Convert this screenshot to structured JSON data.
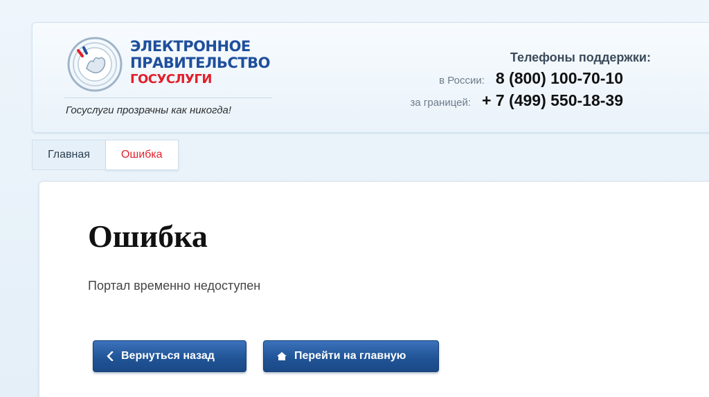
{
  "header": {
    "logo_lines": [
      "ЭЛЕКТРОННОЕ",
      "ПРАВИТЕЛЬСТВО",
      "ГОСУСЛУГИ"
    ],
    "slogan": "Госуслуги прозрачны как никогда!",
    "support": {
      "title": "Телефоны поддержки:",
      "russia_label": "в России:",
      "russia_phone": "8 (800) 100-70-10",
      "abroad_label": "за границей:",
      "abroad_phone": "+ 7 (499) 550-18-39"
    }
  },
  "breadcrumb": {
    "items": [
      {
        "label": "Главная"
      },
      {
        "label": "Ошибка"
      }
    ]
  },
  "main": {
    "title": "Ошибка",
    "message": "Портал временно недоступен",
    "back_label": "Вернуться назад",
    "home_label": "Перейти на главную"
  },
  "icons": {
    "logo": "gosuslugi-emblem-icon",
    "back": "chevron-left-icon",
    "home": "house-icon"
  },
  "colors": {
    "brand_blue": "#1f4f9c",
    "brand_red": "#e21f2b",
    "button_blue": "#215597"
  }
}
